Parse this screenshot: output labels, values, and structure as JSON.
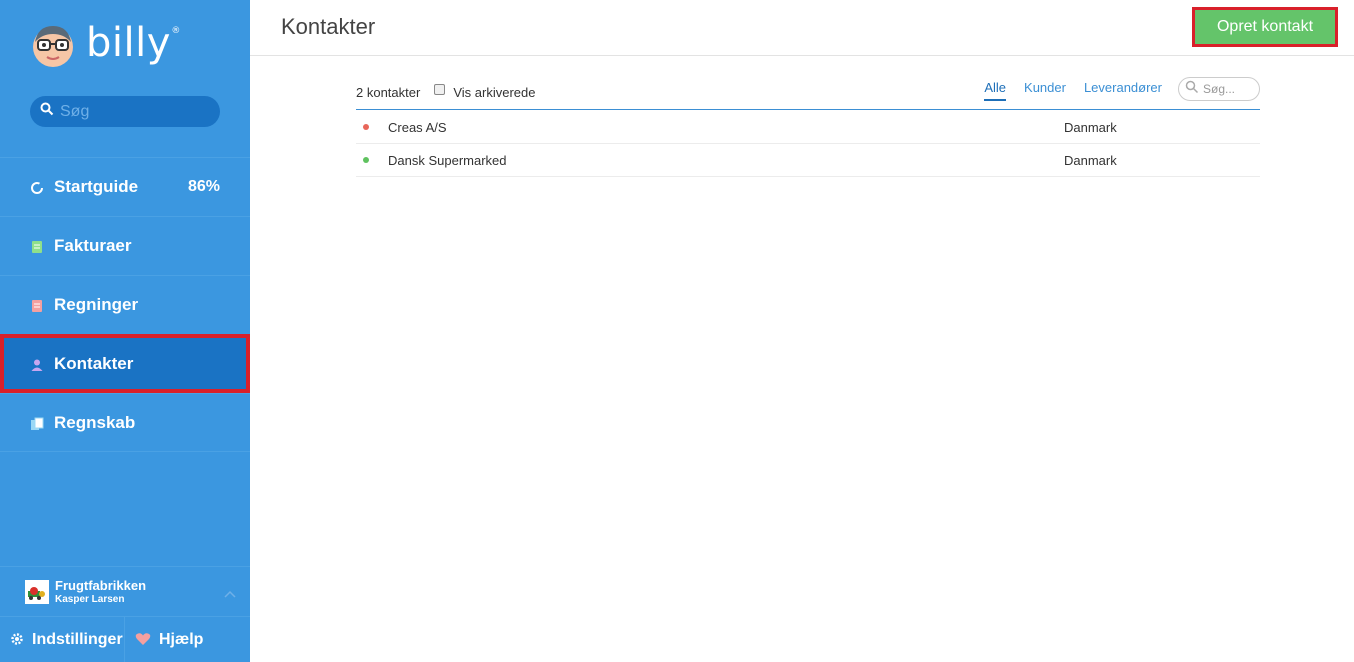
{
  "brand": {
    "name": "billy",
    "reg": "®"
  },
  "sidebar": {
    "search_placeholder": "Søg",
    "items": [
      {
        "label": "Startguide",
        "badge": "86%",
        "icon": "progress-ring-icon"
      },
      {
        "label": "Fakturaer",
        "icon": "invoice-icon"
      },
      {
        "label": "Regninger",
        "icon": "bill-icon"
      },
      {
        "label": "Kontakter",
        "icon": "person-icon"
      },
      {
        "label": "Regnskab",
        "icon": "ledger-icon"
      }
    ],
    "org": {
      "name": "Frugtfabrikken",
      "user": "Kasper Larsen"
    },
    "bottom": {
      "settings": "Indstillinger",
      "help": "Hjælp"
    }
  },
  "header": {
    "title": "Kontakter",
    "create_button": "Opret kontakt"
  },
  "toolbar": {
    "count": "2 kontakter",
    "archive_label": "Vis arkiverede",
    "filters": [
      "Alle",
      "Kunder",
      "Leverandører"
    ],
    "search_placeholder": "Søg..."
  },
  "contacts": [
    {
      "name": "Creas A/S",
      "country": "Danmark",
      "status_color": "#e8665a"
    },
    {
      "name": "Dansk Supermarked",
      "country": "Danmark",
      "status_color": "#5fc25f"
    }
  ],
  "colors": {
    "sidebar": "#3b97e0",
    "active": "#1a73c4",
    "primary_button": "#64c46a",
    "highlight": "#d9202a"
  }
}
